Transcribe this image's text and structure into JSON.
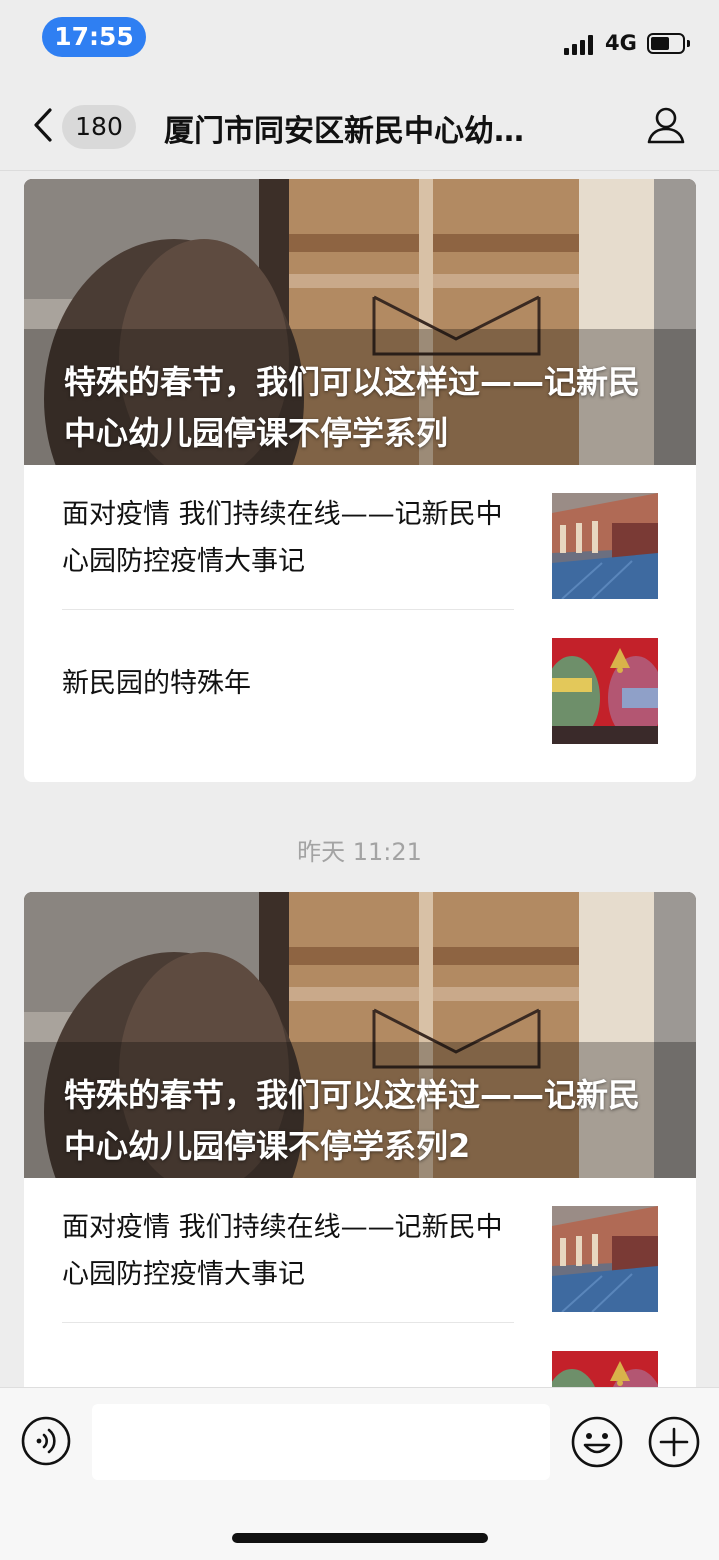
{
  "status_bar": {
    "time": "17:55",
    "network": "4G",
    "battery_level": 0.5
  },
  "nav": {
    "unread_count": "180",
    "title": "厦门市同安区新民中心幼…"
  },
  "timestamp": "昨天 11:21",
  "cards": [
    {
      "cover_title": "特殊的春节，我们可以这样过——记新民中心幼儿园停课不停学系列",
      "items": [
        {
          "title": "面对疫情 我们持续在线——记新民中心园防控疫情大事记",
          "thumb": "school-building"
        },
        {
          "title": "新民园的特殊年",
          "thumb": "red-collage"
        }
      ]
    },
    {
      "cover_title": "特殊的春节，我们可以这样过——记新民中心幼儿园停课不停学系列2",
      "items": [
        {
          "title": "面对疫情 我们持续在线——记新民中心园防控疫情大事记",
          "thumb": "school-building"
        },
        {
          "title": "",
          "thumb": "red-collage"
        }
      ]
    }
  ],
  "icons": {
    "back": "chevron-left-icon",
    "profile": "person-icon",
    "voice": "voice-icon",
    "emoji": "smile-icon",
    "more": "plus-icon"
  },
  "colors": {
    "time_pill": "#2f7ff2",
    "background": "#ededed"
  }
}
